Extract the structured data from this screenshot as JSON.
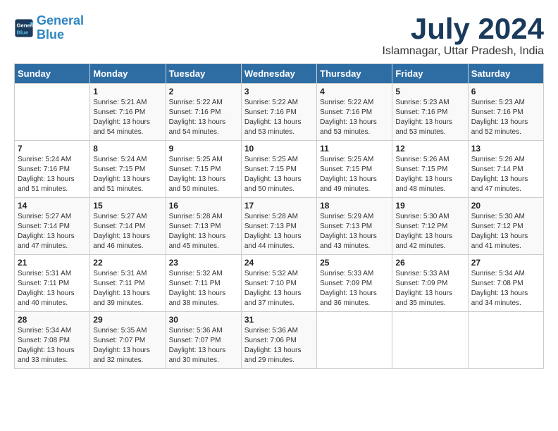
{
  "logo": {
    "line1": "General",
    "line2": "Blue"
  },
  "title": "July 2024",
  "location": "Islamnagar, Uttar Pradesh, India",
  "days_of_week": [
    "Sunday",
    "Monday",
    "Tuesday",
    "Wednesday",
    "Thursday",
    "Friday",
    "Saturday"
  ],
  "weeks": [
    [
      {
        "day": "",
        "sunrise": "",
        "sunset": "",
        "daylight": ""
      },
      {
        "day": "1",
        "sunrise": "5:21 AM",
        "sunset": "7:16 PM",
        "daylight": "13 hours and 54 minutes."
      },
      {
        "day": "2",
        "sunrise": "5:22 AM",
        "sunset": "7:16 PM",
        "daylight": "13 hours and 54 minutes."
      },
      {
        "day": "3",
        "sunrise": "5:22 AM",
        "sunset": "7:16 PM",
        "daylight": "13 hours and 53 minutes."
      },
      {
        "day": "4",
        "sunrise": "5:22 AM",
        "sunset": "7:16 PM",
        "daylight": "13 hours and 53 minutes."
      },
      {
        "day": "5",
        "sunrise": "5:23 AM",
        "sunset": "7:16 PM",
        "daylight": "13 hours and 53 minutes."
      },
      {
        "day": "6",
        "sunrise": "5:23 AM",
        "sunset": "7:16 PM",
        "daylight": "13 hours and 52 minutes."
      }
    ],
    [
      {
        "day": "7",
        "sunrise": "5:24 AM",
        "sunset": "7:16 PM",
        "daylight": "13 hours and 51 minutes."
      },
      {
        "day": "8",
        "sunrise": "5:24 AM",
        "sunset": "7:15 PM",
        "daylight": "13 hours and 51 minutes."
      },
      {
        "day": "9",
        "sunrise": "5:25 AM",
        "sunset": "7:15 PM",
        "daylight": "13 hours and 50 minutes."
      },
      {
        "day": "10",
        "sunrise": "5:25 AM",
        "sunset": "7:15 PM",
        "daylight": "13 hours and 50 minutes."
      },
      {
        "day": "11",
        "sunrise": "5:25 AM",
        "sunset": "7:15 PM",
        "daylight": "13 hours and 49 minutes."
      },
      {
        "day": "12",
        "sunrise": "5:26 AM",
        "sunset": "7:15 PM",
        "daylight": "13 hours and 48 minutes."
      },
      {
        "day": "13",
        "sunrise": "5:26 AM",
        "sunset": "7:14 PM",
        "daylight": "13 hours and 47 minutes."
      }
    ],
    [
      {
        "day": "14",
        "sunrise": "5:27 AM",
        "sunset": "7:14 PM",
        "daylight": "13 hours and 47 minutes."
      },
      {
        "day": "15",
        "sunrise": "5:27 AM",
        "sunset": "7:14 PM",
        "daylight": "13 hours and 46 minutes."
      },
      {
        "day": "16",
        "sunrise": "5:28 AM",
        "sunset": "7:13 PM",
        "daylight": "13 hours and 45 minutes."
      },
      {
        "day": "17",
        "sunrise": "5:28 AM",
        "sunset": "7:13 PM",
        "daylight": "13 hours and 44 minutes."
      },
      {
        "day": "18",
        "sunrise": "5:29 AM",
        "sunset": "7:13 PM",
        "daylight": "13 hours and 43 minutes."
      },
      {
        "day": "19",
        "sunrise": "5:30 AM",
        "sunset": "7:12 PM",
        "daylight": "13 hours and 42 minutes."
      },
      {
        "day": "20",
        "sunrise": "5:30 AM",
        "sunset": "7:12 PM",
        "daylight": "13 hours and 41 minutes."
      }
    ],
    [
      {
        "day": "21",
        "sunrise": "5:31 AM",
        "sunset": "7:11 PM",
        "daylight": "13 hours and 40 minutes."
      },
      {
        "day": "22",
        "sunrise": "5:31 AM",
        "sunset": "7:11 PM",
        "daylight": "13 hours and 39 minutes."
      },
      {
        "day": "23",
        "sunrise": "5:32 AM",
        "sunset": "7:11 PM",
        "daylight": "13 hours and 38 minutes."
      },
      {
        "day": "24",
        "sunrise": "5:32 AM",
        "sunset": "7:10 PM",
        "daylight": "13 hours and 37 minutes."
      },
      {
        "day": "25",
        "sunrise": "5:33 AM",
        "sunset": "7:09 PM",
        "daylight": "13 hours and 36 minutes."
      },
      {
        "day": "26",
        "sunrise": "5:33 AM",
        "sunset": "7:09 PM",
        "daylight": "13 hours and 35 minutes."
      },
      {
        "day": "27",
        "sunrise": "5:34 AM",
        "sunset": "7:08 PM",
        "daylight": "13 hours and 34 minutes."
      }
    ],
    [
      {
        "day": "28",
        "sunrise": "5:34 AM",
        "sunset": "7:08 PM",
        "daylight": "13 hours and 33 minutes."
      },
      {
        "day": "29",
        "sunrise": "5:35 AM",
        "sunset": "7:07 PM",
        "daylight": "13 hours and 32 minutes."
      },
      {
        "day": "30",
        "sunrise": "5:36 AM",
        "sunset": "7:07 PM",
        "daylight": "13 hours and 30 minutes."
      },
      {
        "day": "31",
        "sunrise": "5:36 AM",
        "sunset": "7:06 PM",
        "daylight": "13 hours and 29 minutes."
      },
      {
        "day": "",
        "sunrise": "",
        "sunset": "",
        "daylight": ""
      },
      {
        "day": "",
        "sunrise": "",
        "sunset": "",
        "daylight": ""
      },
      {
        "day": "",
        "sunrise": "",
        "sunset": "",
        "daylight": ""
      }
    ]
  ]
}
